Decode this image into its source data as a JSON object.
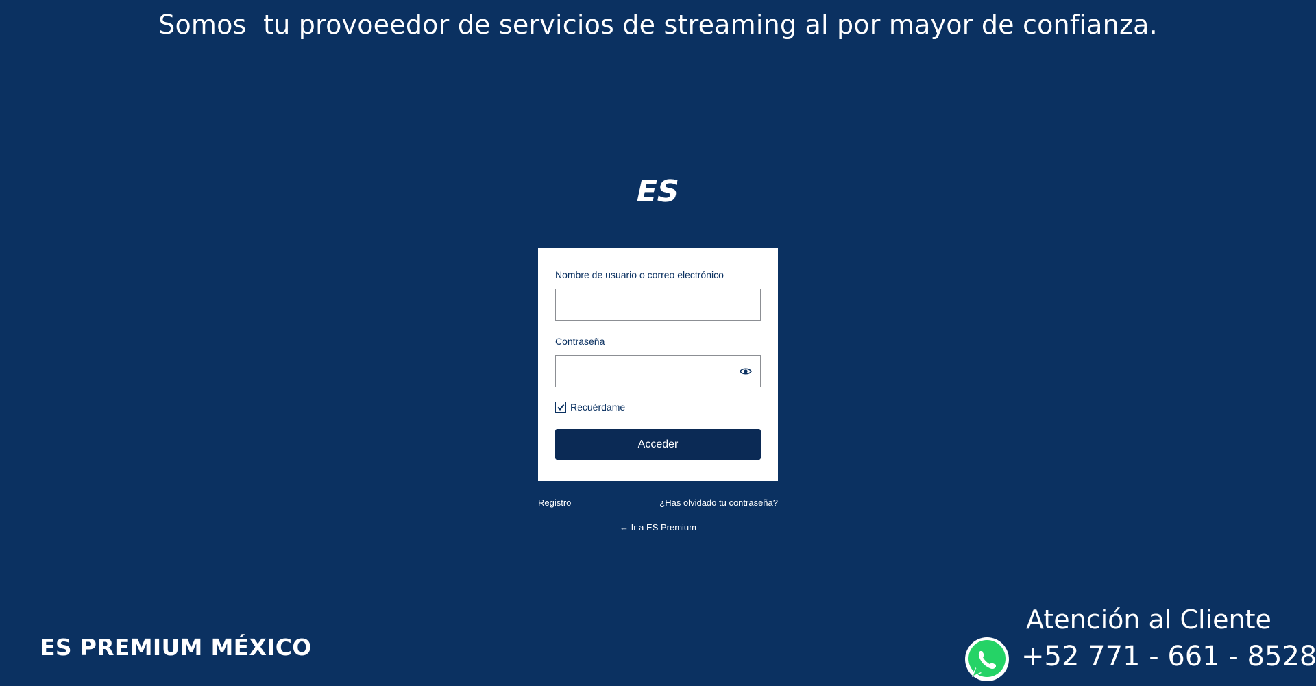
{
  "header": {
    "headline": "Somos  tu provoeedor de servicios de streaming al por mayor de confianza."
  },
  "logo": {
    "text": "ES"
  },
  "login_form": {
    "username_label": "Nombre de usuario o correo electrónico",
    "username_value": "",
    "password_label": "Contraseña",
    "password_value": "",
    "remember_label": "Recuérdame",
    "remember_checked": true,
    "submit_label": "Acceder"
  },
  "links": {
    "register": "Registro",
    "lost_password": "¿Has olvidado tu contraseña?",
    "back_to_site": "← Ir a ES Premium"
  },
  "footer": {
    "brand": "ES PREMIUM MÉXICO",
    "support_title": "Atención al Cliente",
    "support_phone": "+52 771 - 661 - 8528"
  },
  "colors": {
    "background": "#0b3161",
    "button": "#0b2a55",
    "card": "#ffffff",
    "whatsapp_green": "#25d366"
  },
  "icons": {
    "password_toggle": "eye-icon",
    "remember_check": "checkmark-icon",
    "support": "whatsapp-icon"
  }
}
